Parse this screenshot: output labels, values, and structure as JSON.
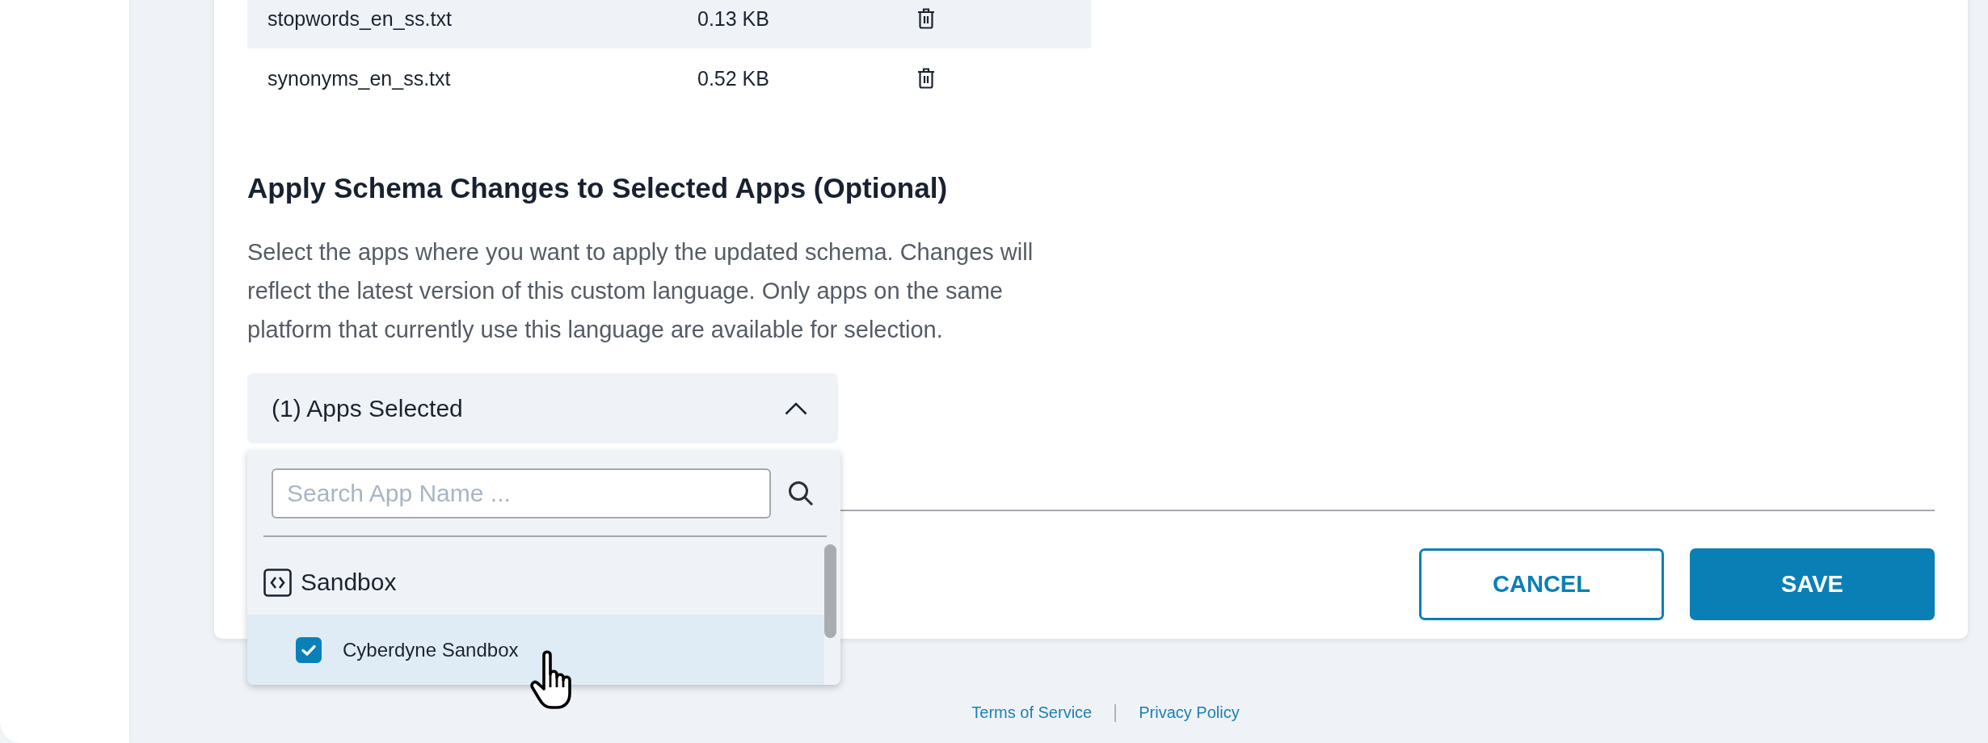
{
  "file_table": {
    "rows": [
      {
        "name": "stopwords_en_ss.txt",
        "size": "0.13 KB"
      },
      {
        "name": "synonyms_en_ss.txt",
        "size": "0.52 KB"
      }
    ]
  },
  "apply_section": {
    "title": "Apply Schema Changes to Selected Apps (Optional)",
    "description": "Select the apps where you want to apply the updated schema. Changes will reflect the latest version of this custom language. Only apps on the same platform that currently use this language are available for selection."
  },
  "app_select": {
    "summary": "(1) Apps Selected",
    "expanded": true,
    "search": {
      "placeholder": "Search App Name ..."
    },
    "groups": [
      {
        "name": "Sandbox",
        "apps": [
          {
            "name": "Cyberdyne Sandbox",
            "checked": true,
            "hovered": true
          }
        ]
      }
    ]
  },
  "buttons": [
    {
      "label": "CANCEL",
      "kind": "secondary"
    },
    {
      "label": "SAVE",
      "kind": "primary"
    }
  ],
  "footer": {
    "links": [
      "Terms of Service",
      "Privacy Policy"
    ]
  }
}
